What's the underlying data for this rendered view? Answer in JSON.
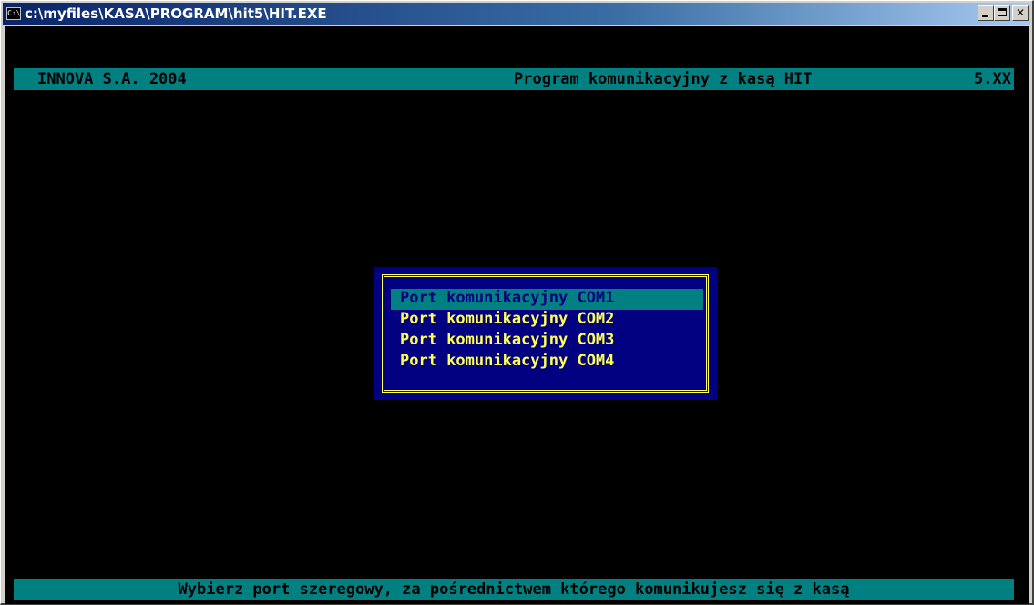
{
  "window": {
    "title": "c:\\myfiles\\KASA\\PROGRAM\\hit5\\HIT.EXE",
    "icon_label": "C:\\",
    "icon": "console-icon"
  },
  "header": {
    "left": "INNOVA S.A. 2004",
    "middle": "Program komunikacyjny z kasą HIT",
    "right": "5.XX"
  },
  "menu": {
    "items": [
      {
        "label": "Port komunikacyjny COM1",
        "selected": true
      },
      {
        "label": "Port komunikacyjny COM2",
        "selected": false
      },
      {
        "label": "Port komunikacyjny COM3",
        "selected": false
      },
      {
        "label": "Port komunikacyjny COM4",
        "selected": false
      }
    ]
  },
  "status": {
    "text": "Wybierz port szeregowy, za pośrednictwem którego komunikujesz się z kasą"
  },
  "colors": {
    "background": "#000000",
    "bar": "#008080",
    "dialog": "#000080",
    "highlight_text": "#ffff55"
  }
}
